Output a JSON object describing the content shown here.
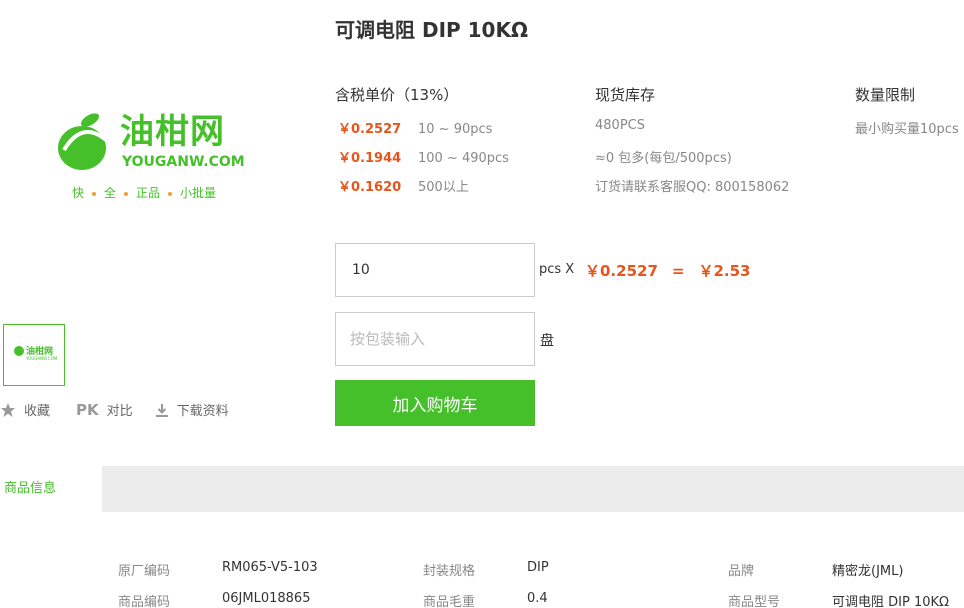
{
  "product": {
    "title": "可调电阻 DIP 10KΩ"
  },
  "logo": {
    "cn": "油柑网",
    "en": "YOUGANW.COM",
    "slogan": [
      "快",
      "全",
      "正品",
      "小批量"
    ]
  },
  "colors": {
    "accent": "#45c02a",
    "price": "#e8541c"
  },
  "actions": {
    "favorite": "收藏",
    "pk": "PK",
    "compare": "对比",
    "download": "下载资料"
  },
  "pricing": {
    "header": "含税单价（13%）",
    "tiers": [
      {
        "price": "￥0.2527",
        "range": "10 ~ 90pcs"
      },
      {
        "price": "￥0.1944",
        "range": "100 ~ 490pcs"
      },
      {
        "price": "￥0.1620",
        "range": "500以上"
      }
    ]
  },
  "stock": {
    "header": "现货库存",
    "lines": [
      "480PCS",
      "≈0 包多(每包/500pcs)",
      "订货请联系客服QQ: 800158062"
    ]
  },
  "limit": {
    "header": "数量限制",
    "text": "最小购买量10pcs"
  },
  "order": {
    "qty_value": "10",
    "qty_unit": "pcs X",
    "unit_price": "￥0.2527",
    "equals": "=",
    "total": "￥2.53",
    "pack_placeholder": "按包装输入",
    "pack_unit": "盘",
    "cart_label": "加入购物车"
  },
  "tabs": {
    "info": "商品信息"
  },
  "specs": [
    {
      "k": "原厂编码",
      "v": "RM065-V5-103"
    },
    {
      "k": "封装规格",
      "v": "DIP"
    },
    {
      "k": "品牌",
      "v": "精密龙(JML)"
    },
    {
      "k": "商品编码",
      "v": "06JML018865"
    },
    {
      "k": "商品毛重",
      "v": "0.4"
    },
    {
      "k": "商品型号",
      "v": "可调电阻 DIP 10KΩ"
    }
  ]
}
